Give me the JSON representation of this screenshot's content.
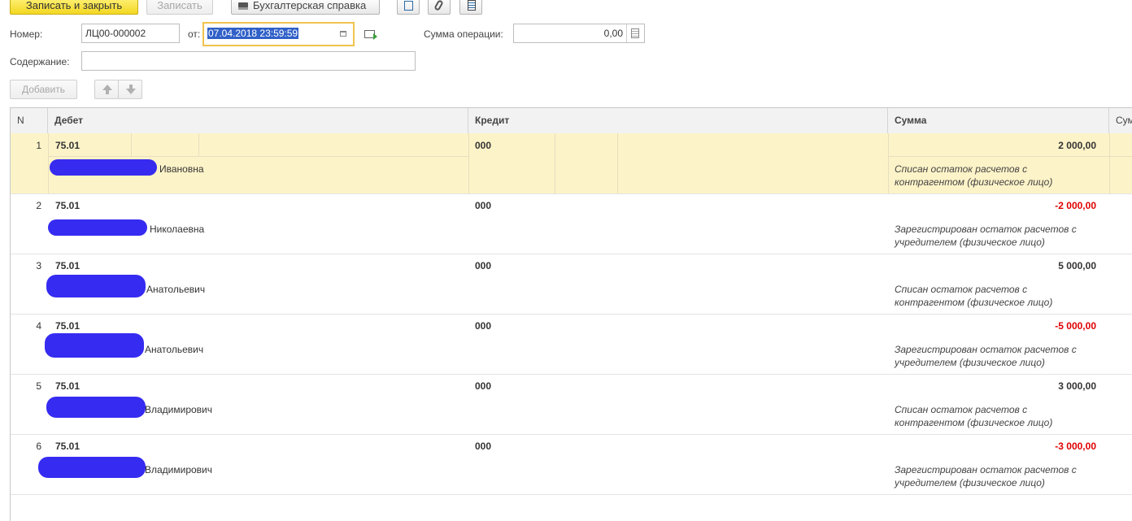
{
  "toolbar": {
    "save_close": "Записать и закрыть",
    "save": "Записать",
    "print_label": "Бухгалтерская справка",
    "icons": [
      "structure-icon",
      "attachment-icon",
      "report-icon"
    ]
  },
  "form": {
    "number_label": "Номер:",
    "number_value": "ЛЦ00-000002",
    "date_label": "от:",
    "date_value": "07.04.2018 23:59:59",
    "sum_label": "Сумма операции:",
    "sum_value": "0,00",
    "content_label": "Содержание:",
    "content_value": ""
  },
  "table_toolbar": {
    "add_label": "Добавить"
  },
  "table": {
    "columns": [
      "N",
      "Дебет",
      "Кредит",
      "Сумма",
      "Сум"
    ],
    "rows": [
      {
        "n": "1",
        "debit": "75.01",
        "person_suffix": "Ивановна",
        "credit": "000",
        "amount": "2 000,00",
        "negative": false,
        "comment1": "Списан остаток расчетов с",
        "comment2": "контрагентом (физическое лицо)"
      },
      {
        "n": "2",
        "debit": "75.01",
        "person_suffix": "Николаевна",
        "credit": "000",
        "amount": "-2 000,00",
        "negative": true,
        "comment1": "Зарегистрирован остаток расчетов с",
        "comment2": "учредителем (физическое лицо)"
      },
      {
        "n": "3",
        "debit": "75.01",
        "person_suffix": "Анатольевич",
        "credit": "000",
        "amount": "5 000,00",
        "negative": false,
        "comment1": "Списан остаток расчетов с",
        "comment2": "контрагентом (физическое лицо)"
      },
      {
        "n": "4",
        "debit": "75.01",
        "person_suffix": "Анатольевич",
        "credit": "000",
        "amount": "-5 000,00",
        "negative": true,
        "comment1": "Зарегистрирован остаток расчетов с",
        "comment2": "учредителем (физическое лицо)"
      },
      {
        "n": "5",
        "debit": "75.01",
        "person_suffix": "Владимирович",
        "credit": "000",
        "amount": "3 000,00",
        "negative": false,
        "comment1": "Списан остаток расчетов с",
        "comment2": "контрагентом (физическое лицо)"
      },
      {
        "n": "6",
        "debit": "75.01",
        "person_suffix": "Владимирович",
        "credit": "000",
        "amount": "-3 000,00",
        "negative": true,
        "comment1": "Зарегистрирован остаток расчетов с",
        "comment2": "учредителем (физическое лицо)"
      }
    ]
  },
  "colors": {
    "primary_button": "#f2d722",
    "selected_row": "#fdf3c8",
    "negative_amount": "#e00000",
    "redaction": "#2b20f0"
  }
}
